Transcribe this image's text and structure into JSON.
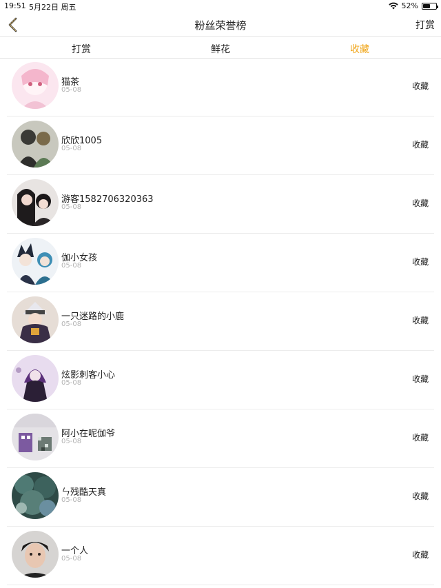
{
  "status": {
    "time": "19:51",
    "date": "5月22日 周五",
    "battery": "52%"
  },
  "nav": {
    "title": "粉丝荣誉榜",
    "right_label": "打赏"
  },
  "tabs": [
    {
      "label": "打赏",
      "active": false
    },
    {
      "label": "鲜花",
      "active": false
    },
    {
      "label": "收藏",
      "active": true
    }
  ],
  "accent_color": "#f0a61a",
  "fans": [
    {
      "name": "猫茶",
      "date": "05-08",
      "action": "收藏"
    },
    {
      "name": "欣欣1005",
      "date": "05-08",
      "action": "收藏"
    },
    {
      "name": "游客1582706320363",
      "date": "05-08",
      "action": "收藏"
    },
    {
      "name": "伽小女孩",
      "date": "05-08",
      "action": "收藏"
    },
    {
      "name": "一只迷路的小鹿",
      "date": "05-08",
      "action": "收藏"
    },
    {
      "name": "炫影刺客小心",
      "date": "05-08",
      "action": "收藏"
    },
    {
      "name": "阿小在呢伽爷",
      "date": "05-08",
      "action": "收藏"
    },
    {
      "name": "ㄣ残酷天真",
      "date": "05-08",
      "action": "收藏"
    },
    {
      "name": "一个人",
      "date": "05-08",
      "action": "收藏"
    }
  ]
}
